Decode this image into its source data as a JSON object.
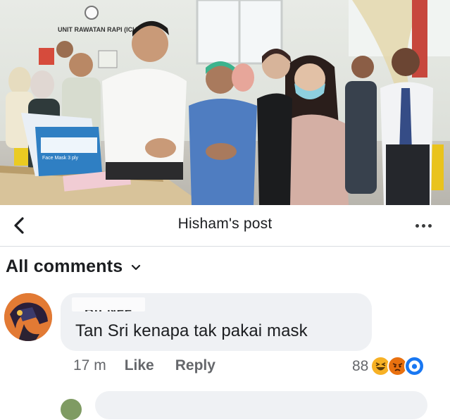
{
  "photo": {
    "sign_text": "UNIT RAWATAN RAPI (ICU)",
    "box_label": "Face Mask 3 ply",
    "icon": "news-photo"
  },
  "header": {
    "title": "Hisham's post",
    "back_icon": "chevron-left-icon",
    "more_icon": "more-horizontal-icon"
  },
  "comments": {
    "filter_label": "All comments",
    "filter_icon": "chevron-down-icon",
    "items": [
      {
        "author": "Bu Nee",
        "text": "Tan Sri kenapa tak pakai mask",
        "time": "17 m",
        "like_label": "Like",
        "reply_label": "Reply",
        "reaction_count": "88",
        "reactions": [
          "haha-icon",
          "angry-icon",
          "wow-icon"
        ]
      }
    ]
  },
  "colors": {
    "bubble": "#eff1f4",
    "meta_text": "#65676b",
    "haha": "#f7b125",
    "angry": "#e9710f",
    "wow": "#1877f2"
  }
}
